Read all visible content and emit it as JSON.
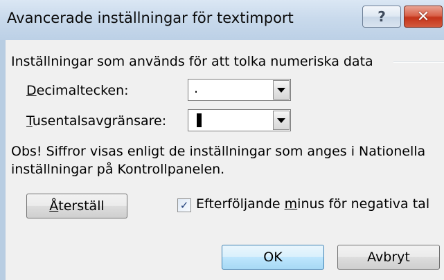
{
  "window": {
    "title": "Avancerade inställningar för textimport",
    "help_label": "?",
    "close_label": "✕"
  },
  "group": {
    "label": "Inställningar som används för att tolka numeriska data"
  },
  "decimal": {
    "label_mnemonic": "D",
    "label_rest": "ecimaltecken:",
    "value": "."
  },
  "thousands": {
    "label_mnemonic": "T",
    "label_rest": "usentalsavgränsare:"
  },
  "note": "Obs! Siffror visas enligt de inställningar som anges i Nationella inställningar på Kontrollpanelen.",
  "reset": {
    "mnemonic": "Å",
    "rest": "terställ"
  },
  "trailing_minus": {
    "checked": true,
    "check_glyph": "✓",
    "label_pre": "Efterföljande ",
    "label_mnemonic": "m",
    "label_post": "inus för negativa tal"
  },
  "buttons": {
    "ok": "OK",
    "cancel": "Avbryt"
  }
}
